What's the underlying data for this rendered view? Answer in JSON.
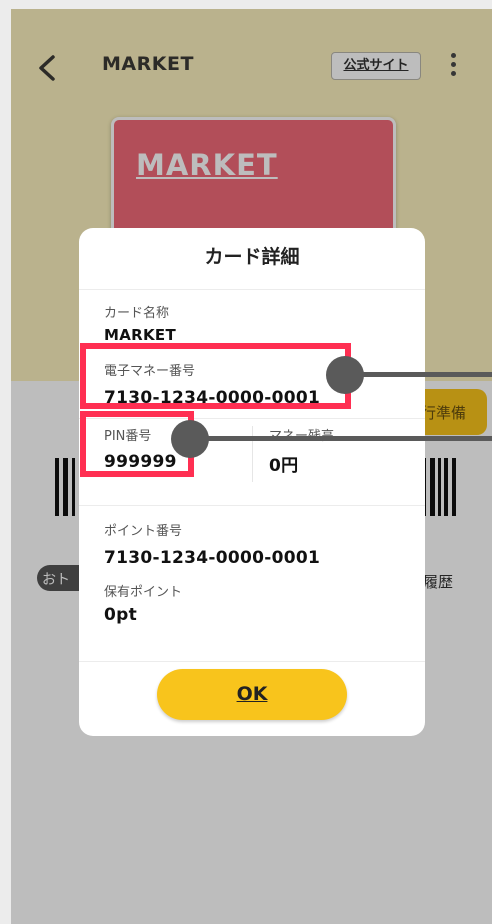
{
  "app": {
    "title": "MARKET",
    "official_site_label": "公式サイト",
    "card_image_text": "MARKET",
    "payment_prep_label": "行準備",
    "otoku_label": "おト",
    "history_label": "履歴"
  },
  "modal": {
    "title": "カード詳細",
    "card_name_label": "カード名称",
    "card_name_value": "MARKET",
    "emoney_number_label": "電子マネー番号",
    "emoney_number_value": "7130-1234-0000-0001",
    "pin_label": "PIN番号",
    "pin_value": "999999",
    "balance_label": "マネー残高",
    "balance_value": "0円",
    "point_number_label": "ポイント番号",
    "point_number_value": "7130-1234-0000-0001",
    "points_held_label": "保有ポイント",
    "points_held_value": "0pt",
    "ok_label": "OK"
  },
  "icons": [
    "back-chevron-icon",
    "more-vertical-icon"
  ],
  "colors": {
    "header_bg": "#fbf1be",
    "card_bg": "#f06a78",
    "accent_yellow": "#f8c41c",
    "highlight_red": "#ff2f52"
  }
}
